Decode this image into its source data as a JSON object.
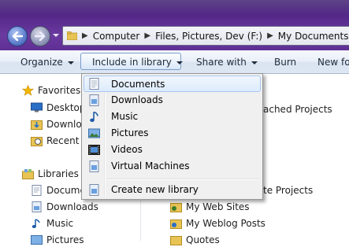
{
  "address": {
    "crumbs": [
      "Computer",
      "Files, Pictures, Dev (F:)",
      "My Documents"
    ]
  },
  "commands": {
    "organize": "Organize",
    "include": "Include in library",
    "share": "Share with",
    "burn": "Burn",
    "newfolder": "New fo"
  },
  "nav": {
    "favorites": "Favorites",
    "desktop": "Desktop",
    "downloads": "Downlo",
    "recent": "Recent P",
    "libraries": "Libraries",
    "lib_documents": "Docume",
    "lib_downloads": "Downloads",
    "lib_music": "Music",
    "lib_pictures": "Pictures"
  },
  "content": {
    "attached": "ached Projects",
    "te": "te Projects",
    "websites": "My Web Sites",
    "weblog": "My Weblog Posts",
    "quotes": "Quotes"
  },
  "menu": {
    "items": [
      "Documents",
      "Downloads",
      "Music",
      "Pictures",
      "Videos",
      "Virtual Machines"
    ],
    "create": "Create new library"
  }
}
